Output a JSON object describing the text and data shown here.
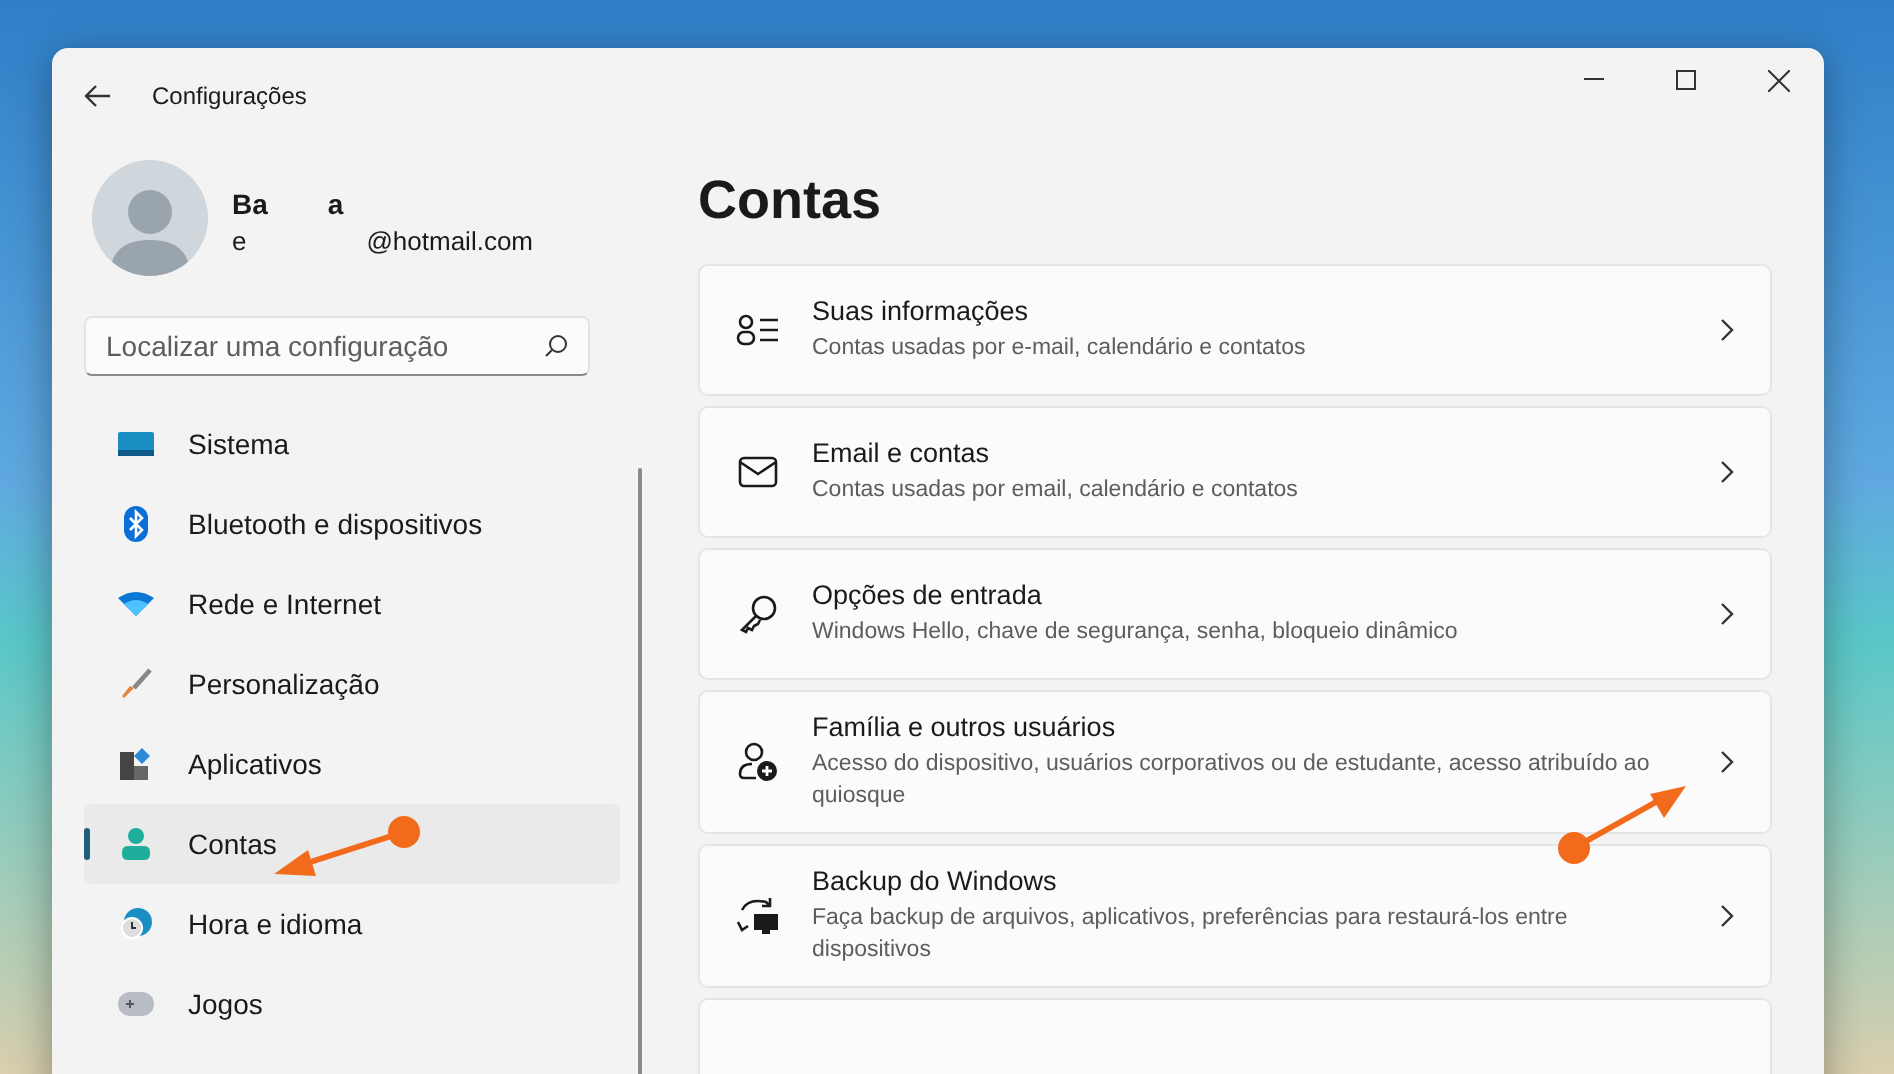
{
  "window": {
    "title": "Configurações"
  },
  "user": {
    "name_fragments": [
      "Ba",
      "a"
    ],
    "email_fragments": [
      "e",
      "@hotmail.com"
    ]
  },
  "search": {
    "placeholder": "Localizar uma configuração"
  },
  "sidebar": {
    "items": [
      {
        "label": "Sistema",
        "kind": "system",
        "selected": false
      },
      {
        "label": "Bluetooth e dispositivos",
        "kind": "bluetooth",
        "selected": false
      },
      {
        "label": "Rede e Internet",
        "kind": "wifi",
        "selected": false
      },
      {
        "label": "Personalização",
        "kind": "brush",
        "selected": false
      },
      {
        "label": "Aplicativos",
        "kind": "apps",
        "selected": false
      },
      {
        "label": "Contas",
        "kind": "person",
        "selected": true
      },
      {
        "label": "Hora e idioma",
        "kind": "globe",
        "selected": false
      },
      {
        "label": "Jogos",
        "kind": "gamepad",
        "selected": false
      }
    ]
  },
  "page": {
    "title": "Contas",
    "items": [
      {
        "kind": "info",
        "title": "Suas informações",
        "description": "Contas usadas por e-mail, calendário e contatos"
      },
      {
        "kind": "mail",
        "title": "Email e contas",
        "description": "Contas usadas por email, calendário e contatos"
      },
      {
        "kind": "key",
        "title": "Opções de entrada",
        "description": "Windows Hello, chave de segurança, senha, bloqueio dinâmico"
      },
      {
        "kind": "family",
        "title": "Família e outros usuários",
        "description": "Acesso do dispositivo, usuários corporativos ou de estudante, acesso atribuído ao quiosque"
      },
      {
        "kind": "backup",
        "title": "Backup do Windows",
        "description": "Faça backup de arquivos, aplicativos, preferências para restaurá-los entre dispositivos"
      }
    ]
  }
}
